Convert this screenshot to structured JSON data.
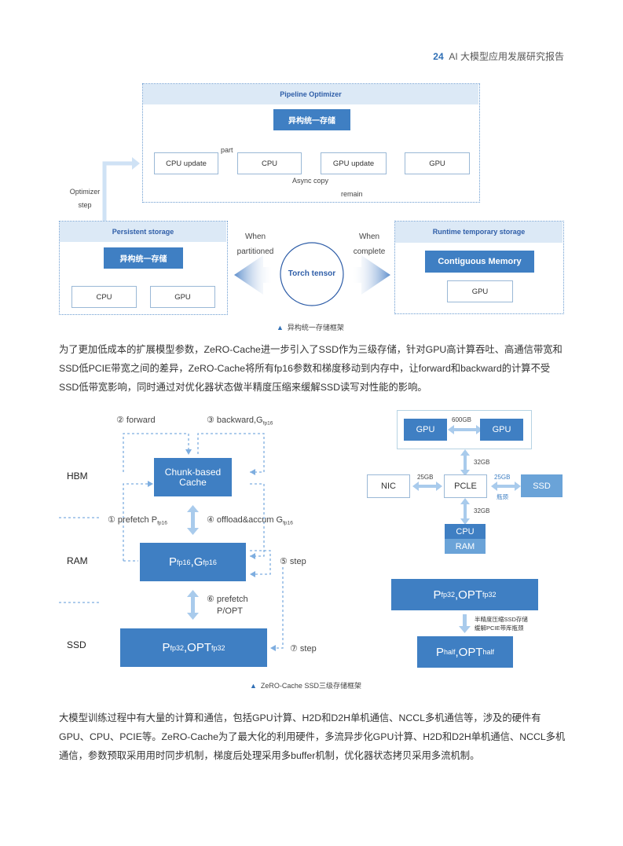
{
  "header": {
    "page_number": "24",
    "report_title": "AI 大模型应用发展研究报告"
  },
  "figure1": {
    "pipeline_title": "Pipeline Optimizer",
    "unified_storage": "异构统一存储",
    "cpu_update": "CPU update",
    "cpu": "CPU",
    "gpu_update": "GPU update",
    "gpu": "GPU",
    "part": "part",
    "async_copy": "Async copy",
    "remain": "remain",
    "optimizer_step": [
      "Optimizer",
      "step"
    ],
    "persistent_title": "Persistent storage",
    "persistent_unified": "异构统一存储",
    "persistent_cpu": "CPU",
    "persistent_gpu": "GPU",
    "when_partitioned": [
      "When",
      "partitioned"
    ],
    "when_complete": [
      "When",
      "complete"
    ],
    "torch_tensor": "Torch tensor",
    "runtime_title": "Runtime temporary storage",
    "contiguous_memory": "Contiguous Memory",
    "runtime_gpu": "GPU",
    "caption": "异构统一存储框架"
  },
  "paragraph1": "为了更加低成本的扩展模型参数，ZeRO-Cache进一步引入了SSD作为三级存储，针对GPU高计算吞吐、高通信带宽和SSD低PCIE带宽之间的差异，ZeRO-Cache将所有fp16参数和梯度移动到内存中，让forward和backward的计算不受SSD低带宽影响，同时通过对优化器状态做半精度压缩来缓解SSD读写对性能的影响。",
  "figure2": {
    "tiers": [
      "HBM",
      "RAM",
      "SSD"
    ],
    "forward": "② forward",
    "backward": "③ backward,G",
    "backward_sub": "fp16",
    "chunk_cache": [
      "Chunk-based",
      "Cache"
    ],
    "prefetch": "① prefetch P",
    "prefetch_sub": "fp16",
    "offload": "④ offload&accum G",
    "offload_sub": "fp16",
    "ram_box": {
      "p": "P",
      "p_sub": "fp16",
      "g": ",G",
      "g_sub": "fp16"
    },
    "step5": "⑤ step",
    "prefetch6": [
      "⑥ prefetch",
      "P/OPT"
    ],
    "ssd_box": {
      "p": "P",
      "p_sub": "fp32",
      "opt": ",OPT",
      "opt_sub": "fp32"
    },
    "step7": "⑦ step",
    "topology": {
      "gpu_a": "GPU",
      "gpu_b": "GPU",
      "nvlink_bw": "600GB",
      "gpu_pcie_bw": "32GB",
      "nic": "NIC",
      "nic_bw": "25GB",
      "pcie": "PCLE",
      "ssd": "SSD",
      "ssd_bw": "25GB",
      "bottleneck": "瓶颈",
      "cpu_bw": "32GB",
      "cpu": "CPU",
      "ram": "RAM"
    },
    "compress": {
      "top": {
        "p": "P",
        "p_sub": "fp32",
        "opt": ",OPT",
        "opt_sub": "fp32"
      },
      "note": [
        "半精度压缩SSD存储",
        "缓解PCIE带库瓶颈"
      ],
      "bottom": {
        "p": "P",
        "p_sub": "half",
        "opt": ",OPT",
        "opt_sub": "half"
      }
    },
    "caption": "ZeRO-Cache SSD三级存储框架"
  },
  "paragraph2": "大模型训练过程中有大量的计算和通信，包括GPU计算、H2D和D2H单机通信、NCCL多机通信等，涉及的硬件有GPU、CPU、PCIE等。ZeRO-Cache为了最大化的利用硬件，多流异步化GPU计算、H2D和D2H单机通信、NCCL多机通信，参数预取采用用时同步机制，梯度后处理采用多buffer机制，优化器状态拷贝采用多流机制。",
  "colors": {
    "accent": "#3f7fc3",
    "light_accent": "#6aa3d8",
    "band": "#dce9f6",
    "arrow": "#a9cbec"
  }
}
